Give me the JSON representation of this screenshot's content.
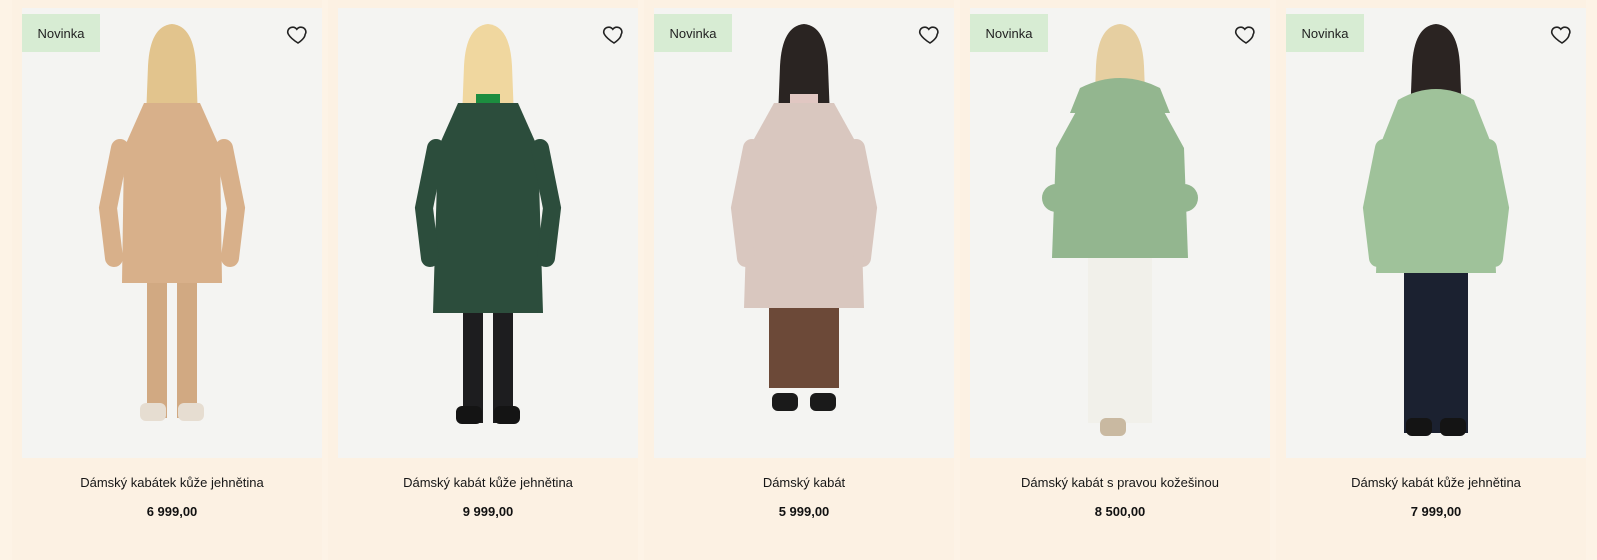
{
  "products": [
    {
      "badge": "Novinka",
      "title": "Dámský kabátek kůže jehnětina",
      "price": "6 999,00",
      "coat_color": "#d8b08a",
      "legs_color": "#d1a982",
      "shoe_color": "#e6ddd1",
      "hair_color": "#e2c48d",
      "top_color": "#d8b08a"
    },
    {
      "badge": "",
      "title": "Dámský kabát kůže jehnětina",
      "price": "9 999,00",
      "coat_color": "#2c4d3c",
      "legs_color": "#1d1d1f",
      "shoe_color": "#141414",
      "hair_color": "#f0d79f",
      "top_color": "#1c8d3f"
    },
    {
      "badge": "Novinka",
      "title": "Dámský kabát",
      "price": "5 999,00",
      "coat_color": "#d9c7bf",
      "legs_color": "#6c4938",
      "shoe_color": "#1a1a1a",
      "hair_color": "#2a2422",
      "top_color": "#e1c7c2"
    },
    {
      "badge": "Novinka",
      "title": "Dámský kabát s pravou kožešinou",
      "price": "8 500,00",
      "coat_color": "#93b68f",
      "legs_color": "#f1f0ea",
      "shoe_color": "#c9b9a1",
      "hair_color": "#e6cfa1",
      "top_color": "#93b68f"
    },
    {
      "badge": "Novinka",
      "title": "Dámský kabát kůže jehnětina",
      "price": "7 999,00",
      "coat_color": "#9fc29a",
      "legs_color": "#1b2130",
      "shoe_color": "#141414",
      "hair_color": "#2b2422",
      "top_color": "#1d1d1d"
    }
  ],
  "icons": {
    "wishlist": "heart-outline-icon"
  }
}
